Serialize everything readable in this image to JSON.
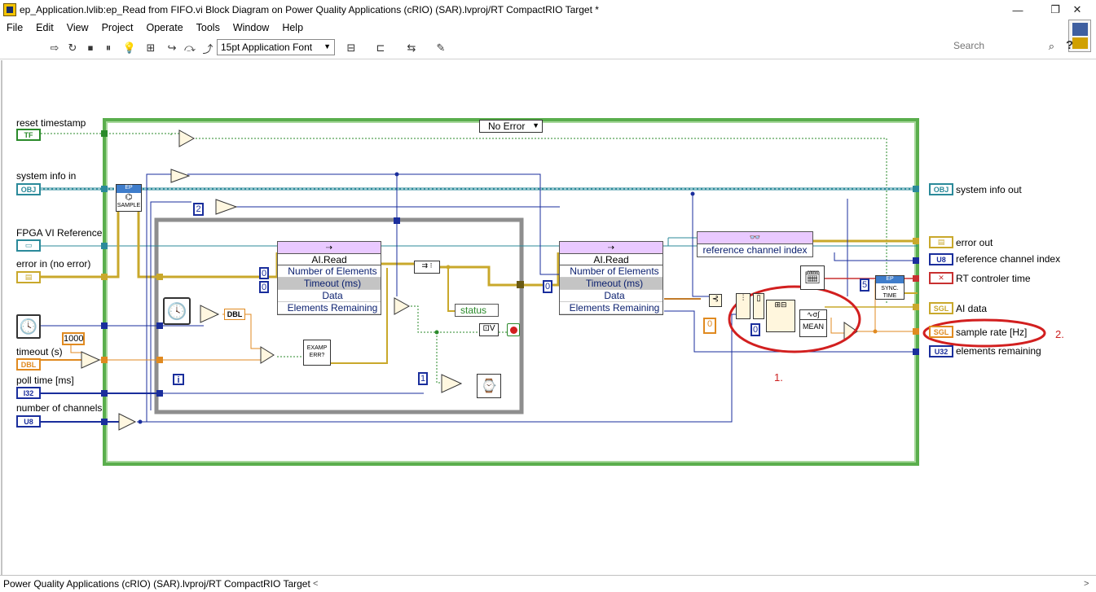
{
  "window": {
    "title": "ep_Application.lvlib:ep_Read from FIFO.vi Block Diagram on Power Quality Applications (cRIO) (SAR).lvproj/RT CompactRIO Target *",
    "minimize_glyph": "—",
    "maximize_glyph": "❐",
    "close_glyph": "✕"
  },
  "menu": {
    "items": [
      "File",
      "Edit",
      "View",
      "Project",
      "Operate",
      "Tools",
      "Window",
      "Help"
    ]
  },
  "toolbar": {
    "font_select": "15pt Application Font",
    "search_placeholder": "Search",
    "help_glyph": "?"
  },
  "diagram": {
    "case_selector": "No Error",
    "inputs": {
      "reset_timestamp": "reset timestamp",
      "system_info_in": "system info in",
      "fpga_vi_reference": "FPGA VI Reference",
      "error_in": "error in (no error)",
      "timeout": "timeout (s)",
      "poll_time": "poll time [ms]",
      "number_of_channels": "number of channels"
    },
    "outputs": {
      "system_info_out": "system info out",
      "error_out": "error out",
      "reference_channel_index": "reference channel index",
      "rt_controler_time": "RT controler time",
      "ai_data": "AI data",
      "sample_rate": "sample rate [Hz]",
      "elements_remaining": "elements remaining"
    },
    "terminal_types": {
      "tf": "TF",
      "obj": "OBJ",
      "dbl": "DBL",
      "i32": "I32",
      "u8": "U8",
      "u32": "U32",
      "sgl": "SGL"
    },
    "fifo_left": {
      "name": "AI.Read",
      "props": [
        "Number of Elements",
        "Timeout (ms)",
        "Data",
        "Elements Remaining"
      ]
    },
    "fifo_right": {
      "name": "AI.Read",
      "props": [
        "Number of Elements",
        "Timeout (ms)",
        "Data",
        "Elements Remaining"
      ]
    },
    "property_node": "reference channel index",
    "constants": {
      "c1000": "1000",
      "c2": "2",
      "c0a": "0",
      "c0b": "0",
      "c0c": "0",
      "c0d": "0",
      "c0e": "0",
      "c1": "1",
      "c5": "5",
      "loop_i": "i"
    },
    "subvi": {
      "sample": "SAMPLE",
      "ep": "EP",
      "example_err": "EXAMP ERR?",
      "sync_time": "SYNC. TIME",
      "mean": "MEAN",
      "status": "status",
      "to_dbl": "DBL"
    },
    "annotations": {
      "one": "1.",
      "two": "2."
    }
  },
  "statusbar": {
    "project": "Power Quality Applications (cRIO) (SAR).lvproj/RT CompactRIO Target",
    "scroll_left": "<",
    "scroll_right": ">"
  },
  "colors": {
    "bool_green": "#2a8a2a",
    "refnum_teal": "#2b8a9a",
    "error_yellow": "#c9a82b",
    "int_blue": "#1a2e9c",
    "dbl_orange": "#e08a20",
    "case_frame": "#5aae4d",
    "annotation_red": "#d21f1f"
  }
}
